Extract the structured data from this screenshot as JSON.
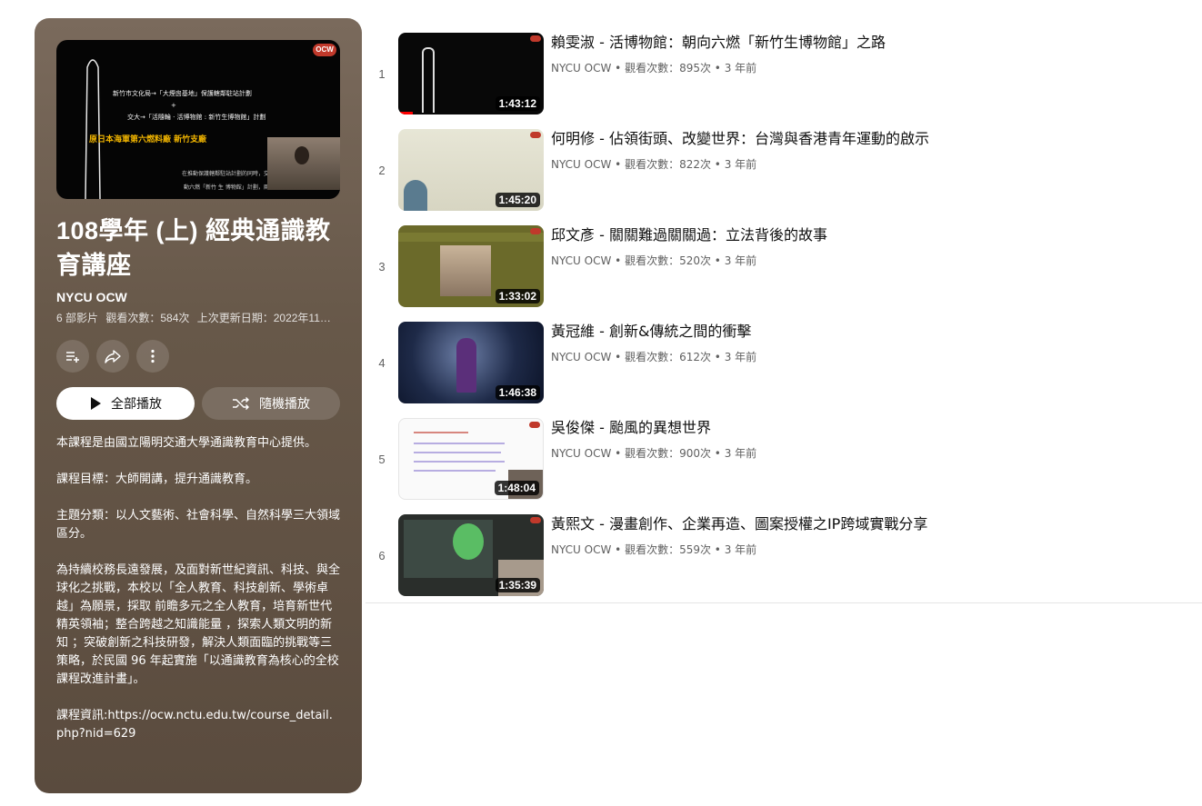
{
  "playlist": {
    "cover_logo": "OCW",
    "cover_lines": [
      "新竹市文化局→「大煙囪基地」保護轄鄰駐站計劃",
      "+",
      "交大→「活隨輪 · 活博物館 : 新竹生博物館」計劃",
      "原日本海軍第六燃料廠 新竹支廠",
      "在推動保護轄鄰駐站計劃的同時，交大也同時推",
      "動六燃「新竹 生 博物館」計劃，兩者相輔相成。"
    ],
    "title": "108學年 (上) 經典通識教育講座",
    "channel": "NYCU OCW",
    "video_count": "6 部影片",
    "views": "觀看次數：584次",
    "updated": "上次更新日期：2022年11月...",
    "icons": [
      "add-to-queue-icon",
      "share-icon",
      "more-icon"
    ],
    "play_all": "全部播放",
    "shuffle": "隨機播放",
    "description": [
      "本課程是由國立陽明交通大學通識教育中心提供。",
      "課程目標：大師開講，提升通識教育。",
      "主題分類：以人文藝術、社會科學、自然科學三大領域區分。",
      "為持續校務長遠發展，及面對新世紀資訊、科技、與全球化之挑戰，本校以「全人教育、科技創新、學術卓越」為願景，採取 前瞻多元之全人教育，培育新世代精英領袖；整合跨越之知識能量 ，探索人類文明的新知 ；突破創新之科技研發，解決人類面臨的挑戰等三策略，於民國 96 年起實施「以通識教育為核心的全校課程改進計畫」。",
      "課程資訊:https://ocw.nctu.edu.tw/course_detail.php?nid=629"
    ]
  },
  "videos": [
    {
      "index": "1",
      "title": "賴雯淑 - 活博物館：朝向六燃「新竹生博物館」之路",
      "channel": "NYCU OCW",
      "views": "觀看次數：895次",
      "age": "3 年前",
      "duration": "1:43:12"
    },
    {
      "index": "2",
      "title": "何明修 - 佔領街頭、改變世界：台灣與香港青年運動的啟示",
      "channel": "NYCU OCW",
      "views": "觀看次數：822次",
      "age": "3 年前",
      "duration": "1:45:20"
    },
    {
      "index": "3",
      "title": "邱文彥 - 關關難過關關過：立法背後的故事",
      "channel": "NYCU OCW",
      "views": "觀看次數：520次",
      "age": "3 年前",
      "duration": "1:33:02"
    },
    {
      "index": "4",
      "title": "黃冠維 - 創新&傳統之間的衝擊",
      "channel": "NYCU OCW",
      "views": "觀看次數：612次",
      "age": "3 年前",
      "duration": "1:46:38"
    },
    {
      "index": "5",
      "title": "吳俊傑 - 颱風的異想世界",
      "channel": "NYCU OCW",
      "views": "觀看次數：900次",
      "age": "3 年前",
      "duration": "1:48:04"
    },
    {
      "index": "6",
      "title": "黃熙文 - 漫畫創作、企業再造、圖案授權之IP跨域實戰分享",
      "channel": "NYCU OCW",
      "views": "觀看次數：559次",
      "age": "3 年前",
      "duration": "1:35:39"
    }
  ],
  "separator": "•"
}
